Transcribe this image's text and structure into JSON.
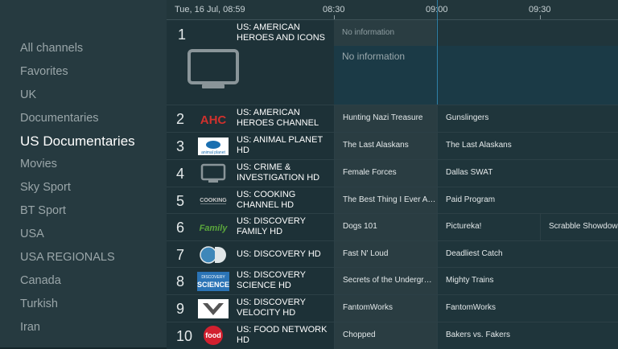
{
  "categories": [
    {
      "label": "All channels",
      "active": false
    },
    {
      "label": "Favorites",
      "active": false
    },
    {
      "label": "UK",
      "active": false
    },
    {
      "label": "Documentaries",
      "active": false
    },
    {
      "label": "US Documentaries",
      "active": true
    },
    {
      "label": "Movies",
      "active": false
    },
    {
      "label": "Sky Sport",
      "active": false
    },
    {
      "label": "BT Sport",
      "active": false
    },
    {
      "label": "USA",
      "active": false
    },
    {
      "label": "USA REGIONALS",
      "active": false
    },
    {
      "label": "Canada",
      "active": false
    },
    {
      "label": "Turkish",
      "active": false
    },
    {
      "label": "Iran",
      "active": false
    }
  ],
  "timebar": {
    "date": "Tue, 16 Jul, 08:59",
    "t1": "08:30",
    "t2": "09:00",
    "t3": "09:30"
  },
  "selected": {
    "number": "1",
    "name": "US: AMERICAN HEROES AND ICONS",
    "prog1": "No information",
    "prog2": "No information",
    "logo_icon": "tv-icon"
  },
  "channels": [
    {
      "number": "2",
      "name": "US: AMERICAN HEROES CHANNEL",
      "logo": "ahc-logo",
      "p1": "Hunting Nazi Treasure",
      "p2": "Gunslingers",
      "p3": ""
    },
    {
      "number": "3",
      "name": "US: ANIMAL PLANET HD",
      "logo": "animal-planet-logo",
      "p1": "The Last Alaskans",
      "p2": "The Last Alaskans",
      "p3": ""
    },
    {
      "number": "4",
      "name": "US: CRIME & INVESTIGATION HD",
      "logo": "tv-icon",
      "p1": "Female Forces",
      "p2": "Dallas SWAT",
      "p3": ""
    },
    {
      "number": "5",
      "name": "US: COOKING CHANNEL HD",
      "logo": "cooking-logo",
      "p1": "The Best Thing I Ever A…",
      "p2": "Paid Program",
      "p3": ""
    },
    {
      "number": "6",
      "name": "US: DISCOVERY FAMILY HD",
      "logo": "discovery-family-logo",
      "p1": "Dogs 101",
      "p2": "Pictureka!",
      "p3": "Scrabble Showdown"
    },
    {
      "number": "7",
      "name": "US: DISCOVERY HD",
      "logo": "discovery-logo",
      "p1": "Fast N' Loud",
      "p2": "Deadliest Catch",
      "p3": ""
    },
    {
      "number": "8",
      "name": "US: DISCOVERY SCIENCE HD",
      "logo": "discovery-science-logo",
      "p1": "Secrets of the Undergr…",
      "p2": "Mighty Trains",
      "p3": ""
    },
    {
      "number": "9",
      "name": "US: DISCOVERY VELOCITY HD",
      "logo": "velocity-logo",
      "p1": "FantomWorks",
      "p2": "FantomWorks",
      "p3": ""
    },
    {
      "number": "10",
      "name": "US: FOOD NETWORK HD",
      "logo": "food-network-logo",
      "p1": "Chopped",
      "p2": "Bakers vs. Fakers",
      "p3": ""
    }
  ],
  "logo_text": {
    "ahc": "AHC",
    "animal": "animal planet",
    "cooking": "COOKING",
    "family": "Family",
    "science_top": "DISCOVERY",
    "science": "SCIENCE",
    "food": "food"
  },
  "colors": {
    "accent_line": "#2f7fa6",
    "sidebar_bg": "#263a40"
  }
}
